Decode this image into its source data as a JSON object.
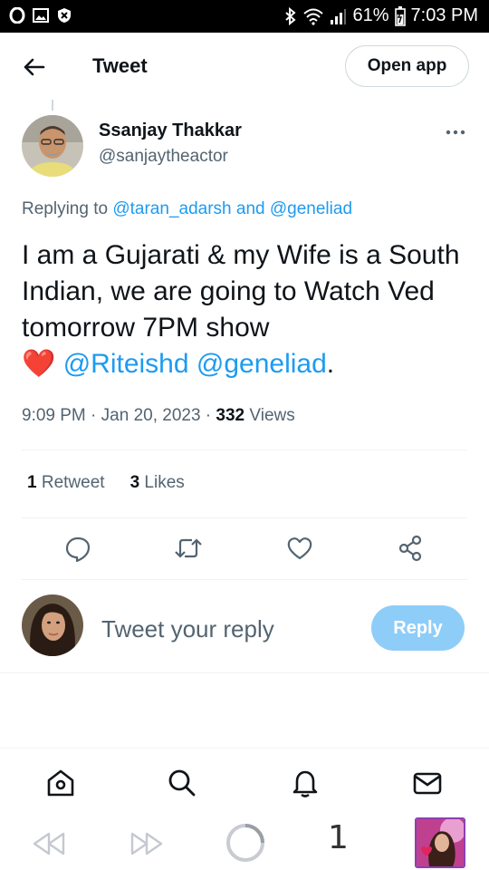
{
  "status_bar": {
    "battery": "61%",
    "time": "7:03 PM"
  },
  "header": {
    "title": "Tweet",
    "open_app": "Open app"
  },
  "tweet": {
    "author_name": "Ssanjay Thakkar",
    "author_handle": "@sanjaytheactor",
    "replying_prefix": "Replying to",
    "replying_user1": "@taran_adarsh",
    "replying_and": "and",
    "replying_user2": "@geneliad",
    "text_main": "I am a Gujarati & my Wife is a South Indian, we are going to Watch Ved tomorrow 7PM show",
    "heart_emoji": "❤️",
    "mention1": "@Riteishd",
    "mention2": "@geneliad",
    "text_end": ".",
    "time": "9:09 PM",
    "date": "Jan 20, 2023",
    "views_count": "332",
    "views_label": "Views",
    "retweets_count": "1",
    "retweets_label": "Retweet",
    "likes_count": "3",
    "likes_label": "Likes"
  },
  "composer": {
    "placeholder": "Tweet your reply",
    "reply_label": "Reply"
  },
  "browser": {
    "tab_count": "1"
  },
  "colors": {
    "accent": "#1d9bf0",
    "reply_disabled": "#8ecdf8",
    "text_secondary": "#536471"
  }
}
